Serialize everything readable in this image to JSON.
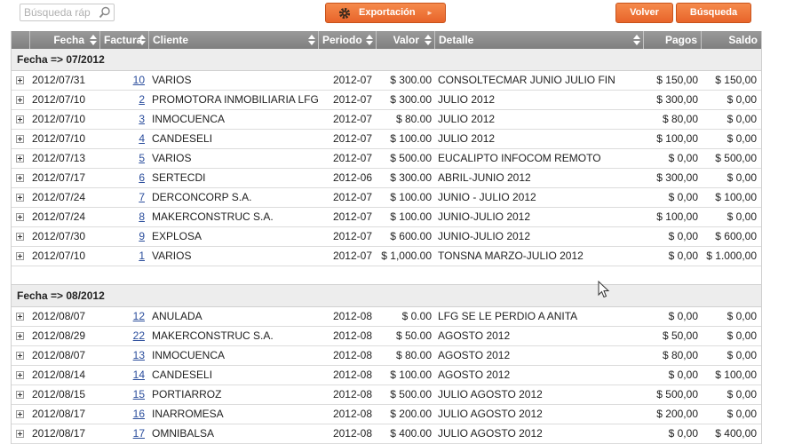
{
  "toolbar": {
    "search_placeholder": "Búsqueda ráp",
    "export_label": "Exportación",
    "volver_label": "Volver",
    "busqueda_label": "Búsqueda",
    "accent_color": "#ee7436"
  },
  "table": {
    "columns": [
      "Fecha",
      "Factura",
      "Cliente",
      "Periodo",
      "Valor",
      "Detalle",
      "Pagos",
      "Saldo"
    ],
    "groups": [
      {
        "label": "Fecha => 07/2012",
        "rows": [
          {
            "fecha": "2012/07/31",
            "factura": "10",
            "cliente": "VARIOS",
            "periodo": "2012-07",
            "valor": "$ 300.00",
            "detalle": "CONSOLTECMAR JUNIO JULIO FIN",
            "pagos": "$ 150,00",
            "saldo": "$ 150,00"
          },
          {
            "fecha": "2012/07/10",
            "factura": "2",
            "cliente": "PROMOTORA INMOBILIARIA LFG",
            "periodo": "2012-07",
            "valor": "$ 300.00",
            "detalle": "JULIO 2012",
            "pagos": "$ 300,00",
            "saldo": "$ 0,00"
          },
          {
            "fecha": "2012/07/10",
            "factura": "3",
            "cliente": "INMOCUENCA",
            "periodo": "2012-07",
            "valor": "$ 80.00",
            "detalle": "JULIO 2012",
            "pagos": "$ 80,00",
            "saldo": "$ 0,00"
          },
          {
            "fecha": "2012/07/10",
            "factura": "4",
            "cliente": "CANDESELI",
            "periodo": "2012-07",
            "valor": "$ 100.00",
            "detalle": "JULIO 2012",
            "pagos": "$ 100,00",
            "saldo": "$ 0,00"
          },
          {
            "fecha": "2012/07/13",
            "factura": "5",
            "cliente": "VARIOS",
            "periodo": "2012-07",
            "valor": "$ 500.00",
            "detalle": "EUCALIPTO INFOCOM REMOTO",
            "pagos": "$ 0,00",
            "saldo": "$ 500,00"
          },
          {
            "fecha": "2012/07/17",
            "factura": "6",
            "cliente": "SERTECDI",
            "periodo": "2012-06",
            "valor": "$ 300.00",
            "detalle": "ABRIL-JUNIO 2012",
            "pagos": "$ 300,00",
            "saldo": "$ 0,00"
          },
          {
            "fecha": "2012/07/24",
            "factura": "7",
            "cliente": "DERCONCORP S.A.",
            "periodo": "2012-07",
            "valor": "$ 100.00",
            "detalle": "JUNIO - JULIO 2012",
            "pagos": "$ 0,00",
            "saldo": "$ 100,00"
          },
          {
            "fecha": "2012/07/24",
            "factura": "8",
            "cliente": "MAKERCONSTRUC S.A.",
            "periodo": "2012-07",
            "valor": "$ 100.00",
            "detalle": "JUNIO-JULIO 2012",
            "pagos": "$ 100,00",
            "saldo": "$ 0,00"
          },
          {
            "fecha": "2012/07/30",
            "factura": "9",
            "cliente": "EXPLOSA",
            "periodo": "2012-07",
            "valor": "$ 600.00",
            "detalle": "JUNIO-JULIO 2012",
            "pagos": "$ 0,00",
            "saldo": "$ 600,00"
          },
          {
            "fecha": "2012/07/10",
            "factura": "1",
            "cliente": "VARIOS",
            "periodo": "2012-07",
            "valor": "$ 1,000.00",
            "detalle": "TONSNA MARZO-JULIO 2012",
            "pagos": "$ 0,00",
            "saldo": "$ 1.000,00"
          }
        ]
      },
      {
        "label": "Fecha => 08/2012",
        "rows": [
          {
            "fecha": "2012/08/07",
            "factura": "12",
            "cliente": "ANULADA",
            "periodo": "2012-08",
            "valor": "$ 0.00",
            "detalle": "LFG SE LE PERDIO A ANITA",
            "pagos": "$ 0,00",
            "saldo": "$ 0,00"
          },
          {
            "fecha": "2012/08/29",
            "factura": "22",
            "cliente": "MAKERCONSTRUC S.A.",
            "periodo": "2012-08",
            "valor": "$ 50.00",
            "detalle": "AGOSTO 2012",
            "pagos": "$ 50,00",
            "saldo": "$ 0,00"
          },
          {
            "fecha": "2012/08/07",
            "factura": "13",
            "cliente": "INMOCUENCA",
            "periodo": "2012-08",
            "valor": "$ 80.00",
            "detalle": "AGOSTO 2012",
            "pagos": "$ 80,00",
            "saldo": "$ 0,00"
          },
          {
            "fecha": "2012/08/14",
            "factura": "14",
            "cliente": "CANDESELI",
            "periodo": "2012-08",
            "valor": "$ 100.00",
            "detalle": "AGOSTO 2012",
            "pagos": "$ 0,00",
            "saldo": "$ 100,00"
          },
          {
            "fecha": "2012/08/15",
            "factura": "15",
            "cliente": "PORTIARROZ",
            "periodo": "2012-08",
            "valor": "$ 500.00",
            "detalle": "JULIO AGOSTO 2012",
            "pagos": "$ 500,00",
            "saldo": "$ 0,00"
          },
          {
            "fecha": "2012/08/17",
            "factura": "16",
            "cliente": "INARROMESA",
            "periodo": "2012-08",
            "valor": "$ 200.00",
            "detalle": "JULIO AGOSTO 2012",
            "pagos": "$ 200,00",
            "saldo": "$ 0,00"
          },
          {
            "fecha": "2012/08/17",
            "factura": "17",
            "cliente": "OMNIBALSA",
            "periodo": "2012-08",
            "valor": "$ 400.00",
            "detalle": "JULIO AGOSTO 2012",
            "pagos": "$ 0,00",
            "saldo": "$ 400,00"
          }
        ]
      }
    ]
  }
}
